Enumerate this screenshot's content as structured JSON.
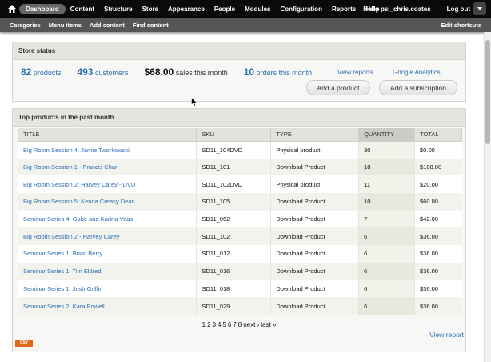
{
  "toolbar": {
    "menu": [
      "Dashboard",
      "Content",
      "Structure",
      "Store",
      "Appearance",
      "People",
      "Modules",
      "Configuration",
      "Reports",
      "Help"
    ],
    "greeting": "Hello psi_chris.coates",
    "logout": "Log out"
  },
  "shortcuts": {
    "links": [
      "Categories",
      "Menu items",
      "Add content",
      "Find content"
    ],
    "edit": "Edit shortcuts"
  },
  "store_status": {
    "title": "Store status",
    "products_num": "82",
    "products_lbl": "products",
    "customers_num": "493",
    "customers_lbl": "customers",
    "sales_num": "$68.00",
    "sales_lbl": "sales this month",
    "orders_num": "10",
    "orders_lbl": "orders this month",
    "view_reports": "View reports...",
    "google_analytics": "Google Analytics...",
    "add_product": "Add a product",
    "add_subscription": "Add a subscription"
  },
  "top_products": {
    "title": "Top products in the past month",
    "columns": [
      "TITLE",
      "SKU",
      "TYPE",
      "QUANTITY",
      "TOTAL"
    ],
    "rows": [
      [
        "Big Room Session 4: Jamie Tworkowski",
        "SD11_104DVD",
        "Physical product",
        "30",
        "$0.00"
      ],
      [
        "Big Room Session 1 - Francis Chan",
        "SD11_101",
        "Download Product",
        "18",
        "$108.00"
      ],
      [
        "Big Room Session 2: Harvey Carey - DVD",
        "SD11_102DVD",
        "Physical product",
        "11",
        "$20.00"
      ],
      [
        "Big Room Session 5: Kenda Creasy Dean",
        "SD11_105",
        "Download Product",
        "10",
        "$60.00"
      ],
      [
        "Seminar Series 4: Gabe and Karina Veas",
        "SD11_062",
        "Download Product",
        "7",
        "$42.00"
      ],
      [
        "Big Room Session 2 - Harvey Carey",
        "SD11_102",
        "Download Product",
        "6",
        "$36.00"
      ],
      [
        "Seminar Series 1: Brian Berry",
        "SD11_012",
        "Download Product",
        "6",
        "$36.00"
      ],
      [
        "Seminar Series 1: Tim Eldred",
        "SD11_016",
        "Download Product",
        "6",
        "$36.00"
      ],
      [
        "Seminar Series 1: Josh Griffin",
        "SD11_018",
        "Download Product",
        "6",
        "$36.00"
      ],
      [
        "Seminar Series 2: Kara Powell",
        "SD11_029",
        "Download Product",
        "6",
        "$36.00"
      ]
    ],
    "pager": [
      "1",
      "2",
      "3",
      "4",
      "5",
      "6",
      "7",
      "8",
      "next ›",
      "last »"
    ],
    "view_report": "View report"
  },
  "badge": "CSY",
  "colors": {
    "link": "#2a6eb5",
    "toolbar": "#0a0a0a",
    "badge": "#e06a1b"
  }
}
